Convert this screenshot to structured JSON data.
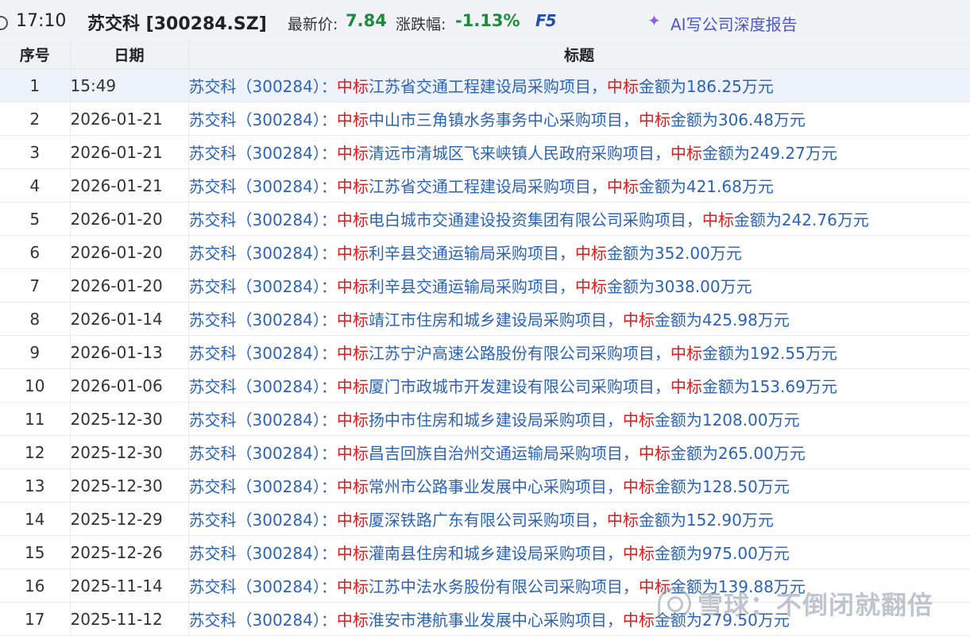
{
  "header": {
    "time": "17:10",
    "stock": "苏交科 [300284.SZ]",
    "price_label": "最新价:",
    "price_value": "7.84",
    "change_label": "涨跌幅:",
    "change_value": "-1.13%",
    "f5_label": "F5",
    "ai_label": "AI写公司深度报告",
    "change_color": "#1e8a3c"
  },
  "table": {
    "columns": [
      "序号",
      "日期",
      "标题"
    ],
    "rows": [
      {
        "idx": "1",
        "date": "15:49",
        "prefix": "苏交科（300284）：",
        "kw1": "中标",
        "mid": "江苏省交通工程建设局采购项目，",
        "kw2": "中标",
        "tail": "金额为186.25万元"
      },
      {
        "idx": "2",
        "date": "2026-01-21",
        "prefix": "苏交科（300284）：",
        "kw1": "中标",
        "mid": "中山市三角镇水务事务中心采购项目，",
        "kw2": "中标",
        "tail": "金额为306.48万元"
      },
      {
        "idx": "3",
        "date": "2026-01-21",
        "prefix": "苏交科（300284）：",
        "kw1": "中标",
        "mid": "清远市清城区飞来峡镇人民政府采购项目，",
        "kw2": "中标",
        "tail": "金额为249.27万元"
      },
      {
        "idx": "4",
        "date": "2026-01-21",
        "prefix": "苏交科（300284）：",
        "kw1": "中标",
        "mid": "江苏省交通工程建设局采购项目，",
        "kw2": "中标",
        "tail": "金额为421.68万元"
      },
      {
        "idx": "5",
        "date": "2026-01-20",
        "prefix": "苏交科（300284）：",
        "kw1": "中标",
        "mid": "电白城市交通建设投资集团有限公司采购项目，",
        "kw2": "中标",
        "tail": "金额为242.76万元"
      },
      {
        "idx": "6",
        "date": "2026-01-20",
        "prefix": "苏交科（300284）：",
        "kw1": "中标",
        "mid": "利辛县交通运输局采购项目，",
        "kw2": "中标",
        "tail": "金额为352.00万元"
      },
      {
        "idx": "7",
        "date": "2026-01-20",
        "prefix": "苏交科（300284）：",
        "kw1": "中标",
        "mid": "利辛县交通运输局采购项目，",
        "kw2": "中标",
        "tail": "金额为3038.00万元"
      },
      {
        "idx": "8",
        "date": "2026-01-14",
        "prefix": "苏交科（300284）：",
        "kw1": "中标",
        "mid": "靖江市住房和城乡建设局采购项目，",
        "kw2": "中标",
        "tail": "金额为425.98万元"
      },
      {
        "idx": "9",
        "date": "2026-01-13",
        "prefix": "苏交科（300284）：",
        "kw1": "中标",
        "mid": "江苏宁沪高速公路股份有限公司采购项目，",
        "kw2": "中标",
        "tail": "金额为192.55万元"
      },
      {
        "idx": "10",
        "date": "2026-01-06",
        "prefix": "苏交科（300284）：",
        "kw1": "中标",
        "mid": "厦门市政城市开发建设有限公司采购项目，",
        "kw2": "中标",
        "tail": "金额为153.69万元"
      },
      {
        "idx": "11",
        "date": "2025-12-30",
        "prefix": "苏交科（300284）：",
        "kw1": "中标",
        "mid": "扬中市住房和城乡建设局采购项目，",
        "kw2": "中标",
        "tail": "金额为1208.00万元"
      },
      {
        "idx": "12",
        "date": "2025-12-30",
        "prefix": "苏交科（300284）：",
        "kw1": "中标",
        "mid": "昌吉回族自治州交通运输局采购项目，",
        "kw2": "中标",
        "tail": "金额为265.00万元"
      },
      {
        "idx": "13",
        "date": "2025-12-30",
        "prefix": "苏交科（300284）：",
        "kw1": "中标",
        "mid": "常州市公路事业发展中心采购项目，",
        "kw2": "中标",
        "tail": "金额为128.50万元"
      },
      {
        "idx": "14",
        "date": "2025-12-29",
        "prefix": "苏交科（300284）：",
        "kw1": "中标",
        "mid": "厦深铁路广东有限公司采购项目，",
        "kw2": "中标",
        "tail": "金额为152.90万元"
      },
      {
        "idx": "15",
        "date": "2025-12-26",
        "prefix": "苏交科（300284）：",
        "kw1": "中标",
        "mid": "灌南县住房和城乡建设局采购项目，",
        "kw2": "中标",
        "tail": "金额为975.00万元"
      },
      {
        "idx": "16",
        "date": "2025-11-14",
        "prefix": "苏交科（300284）：",
        "kw1": "中标",
        "mid": "江苏中法水务股份有限公司采购项目，",
        "kw2": "中标",
        "tail": "金额为139.88万元"
      },
      {
        "idx": "17",
        "date": "2025-11-12",
        "prefix": "苏交科（300284）：",
        "kw1": "中标",
        "mid": "淮安市港航事业发展中心采购项目，",
        "kw2": "中标",
        "tail": "金额为279.50万元"
      }
    ]
  },
  "watermark": {
    "text": "雪球：不倒闭就翻倍"
  }
}
